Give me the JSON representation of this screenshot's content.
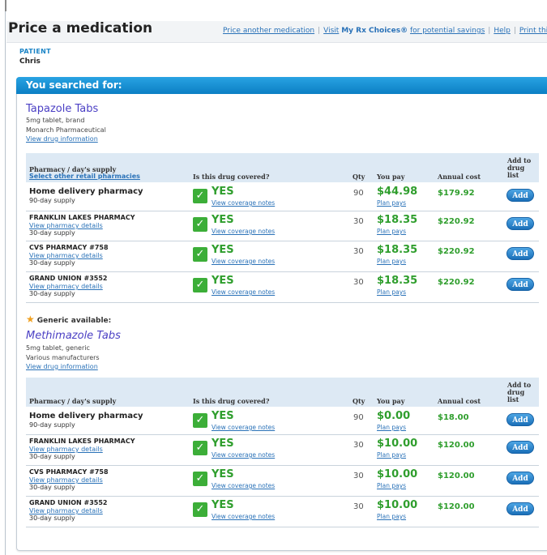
{
  "page": {
    "title": "Price a medication",
    "links": {
      "price_another": "Price another medication",
      "visit_prefix": "Visit",
      "visit_bold": "My Rx Choices®",
      "visit_suffix": "for potential savings",
      "help": "Help",
      "print": "Print this page"
    },
    "patient_label": "PATIENT",
    "patient_name": "Chris",
    "searched_header": "You searched for:",
    "generic_note": "Generic available:"
  },
  "columns": {
    "pharmacy": "Pharmacy / day's supply",
    "select_other": "Select other retail pharmacies",
    "covered": "Is this drug covered?",
    "qty": "Qty",
    "you_pay": "You pay",
    "annual": "Annual cost",
    "add": "Add to drug list",
    "add_lines": [
      "Add to",
      "drug",
      "list"
    ]
  },
  "drugs": [
    {
      "name": "Tapazole Tabs",
      "meta1": "5mg tablet, brand",
      "meta2": "Monarch Pharmaceutical",
      "info_link": "View drug information",
      "rows": [
        {
          "pharmacy": "Home delivery pharmacy",
          "details": "",
          "supply": "90-day supply",
          "covered": "YES",
          "notes": "View coverage notes",
          "qty": "90",
          "pay": "$44.98",
          "plan": "Plan pays",
          "annual": "$179.92",
          "add": "Add"
        },
        {
          "pharmacy": "FRANKLIN LAKES PHARMACY",
          "details": "View pharmacy details",
          "supply": "30-day supply",
          "covered": "YES",
          "notes": "View coverage notes",
          "qty": "30",
          "pay": "$18.35",
          "plan": "Plan pays",
          "annual": "$220.92",
          "add": "Add"
        },
        {
          "pharmacy": "CVS PHARMACY #758",
          "details": "View pharmacy details",
          "supply": "30-day supply",
          "covered": "YES",
          "notes": "View coverage notes",
          "qty": "30",
          "pay": "$18.35",
          "plan": "Plan pays",
          "annual": "$220.92",
          "add": "Add"
        },
        {
          "pharmacy": "GRAND UNION #3552",
          "details": "View pharmacy details",
          "supply": "30-day supply",
          "covered": "YES",
          "notes": "View coverage notes",
          "qty": "30",
          "pay": "$18.35",
          "plan": "Plan pays",
          "annual": "$220.92",
          "add": "Add"
        }
      ]
    },
    {
      "name": "Methimazole Tabs",
      "meta1": "5mg tablet, generic",
      "meta2": "Various manufacturers",
      "info_link": "View drug information",
      "rows": [
        {
          "pharmacy": "Home delivery pharmacy",
          "details": "",
          "supply": "90-day supply",
          "covered": "YES",
          "notes": "View coverage notes",
          "qty": "90",
          "pay": "$0.00",
          "plan": "Plan pays",
          "annual": "$18.00",
          "add": "Add"
        },
        {
          "pharmacy": "FRANKLIN LAKES PHARMACY",
          "details": "View pharmacy details",
          "supply": "30-day supply",
          "covered": "YES",
          "notes": "View coverage notes",
          "qty": "30",
          "pay": "$10.00",
          "plan": "Plan pays",
          "annual": "$120.00",
          "add": "Add"
        },
        {
          "pharmacy": "CVS PHARMACY #758",
          "details": "View pharmacy details",
          "supply": "30-day supply",
          "covered": "YES",
          "notes": "View coverage notes",
          "qty": "30",
          "pay": "$10.00",
          "plan": "Plan pays",
          "annual": "$120.00",
          "add": "Add"
        },
        {
          "pharmacy": "GRAND UNION #3552",
          "details": "View pharmacy details",
          "supply": "30-day supply",
          "covered": "YES",
          "notes": "View coverage notes",
          "qty": "30",
          "pay": "$10.00",
          "plan": "Plan pays",
          "annual": "$120.00",
          "add": "Add"
        }
      ]
    }
  ],
  "colors": {
    "accent_blue": "#1b84c6",
    "price_green": "#2f9e2d",
    "drug_name": "#4a3fc4",
    "header_bar": "#0b7fc4"
  },
  "icons": {
    "covered": "check-icon",
    "generic": "star-icon"
  }
}
